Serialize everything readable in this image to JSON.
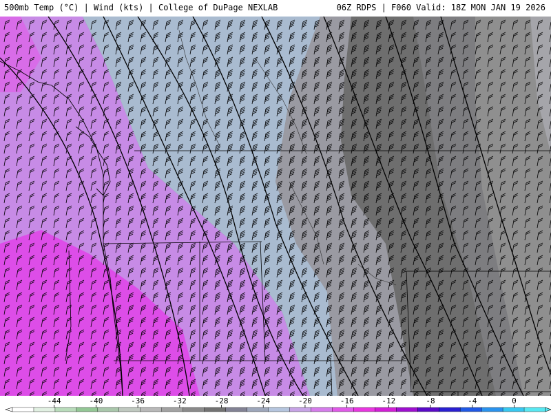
{
  "header": {
    "left_text": "500mb Temp (°C) | Wind (kts) | College of DuPage NEXLAB",
    "right_text": "06Z RDPS | F060 Valid: 18Z MON JAN 19 2026"
  },
  "map": {
    "field": "500mb temperature shading with wind barbs",
    "barb_color": "#000000",
    "contour_color": "#000000",
    "border_color": "#000000",
    "region_colors": {
      "deep_magenta": "#dd4de8",
      "light_purple": "#c78be6",
      "light_blue": "#a9bbd0",
      "gray_light": "#9a9aa2",
      "gray_mid": "#7d7d80",
      "gray_dark": "#6e6e6e",
      "gray_east": "#8f8f8f"
    }
  },
  "colorbar": {
    "tick_labels": [
      "-44",
      "-40",
      "-36",
      "-32",
      "-28",
      "-24",
      "-20",
      "-16",
      "-12",
      "-8",
      "-4",
      "0"
    ],
    "tick_values": [
      -44,
      -40,
      -36,
      -32,
      -28,
      -24,
      -20,
      -16,
      -12,
      -8,
      -4,
      0
    ],
    "range": [
      -48,
      3
    ],
    "colors": [
      "#ffffff",
      "#e1f0e2",
      "#b9dcbb",
      "#93c795",
      "#a9c7ab",
      "#bfc8bf",
      "#b8b8b8",
      "#a2a2a2",
      "#8a8a8a",
      "#727272",
      "#828294",
      "#9da6ba",
      "#b5c5de",
      "#c7a3e6",
      "#d57ceb",
      "#e05ae8",
      "#e836e0",
      "#d21ed6",
      "#9e0fd0",
      "#5a0ac8",
      "#2a20d2",
      "#2059e6",
      "#2a93ee",
      "#38c8f0",
      "#58e8f2"
    ]
  }
}
